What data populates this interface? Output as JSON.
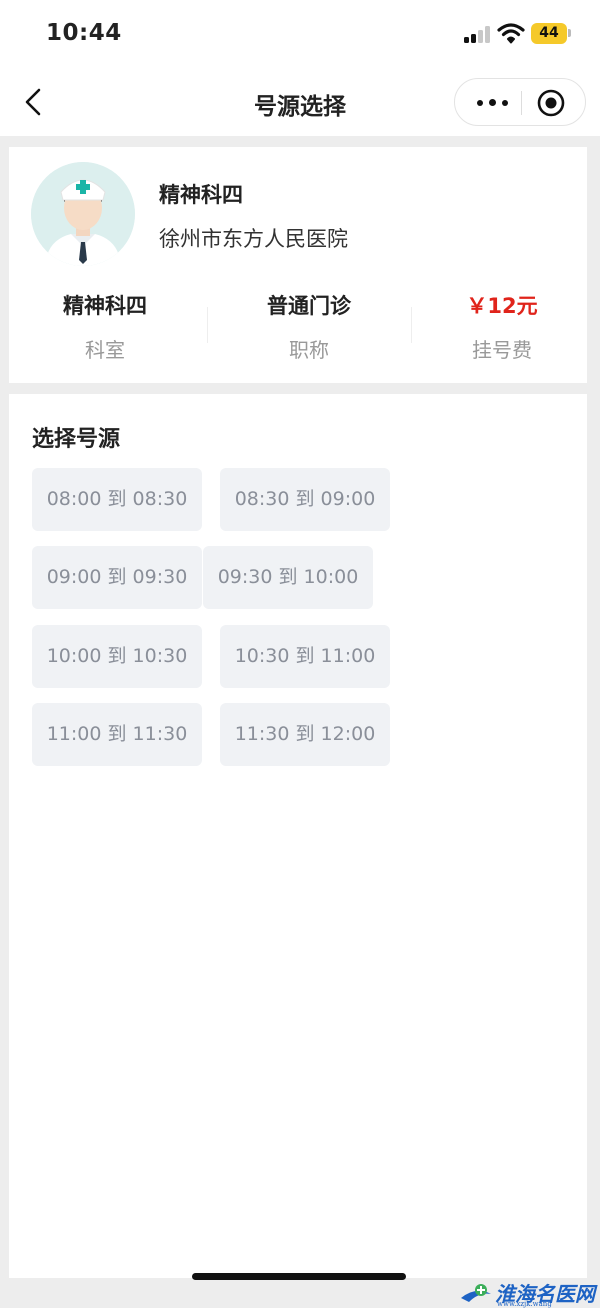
{
  "status_bar": {
    "time": "10:44",
    "battery": "44"
  },
  "nav": {
    "title": "号源选择",
    "icons": [
      "back-icon",
      "more-icon",
      "close-icon"
    ]
  },
  "doctor": {
    "name": "精神科四",
    "hospital": "徐州市东方人民医院",
    "info": [
      {
        "value": "精神科四",
        "label": "科室"
      },
      {
        "value": "普通门诊",
        "label": "职称"
      },
      {
        "value": "￥12元",
        "label": "挂号费"
      }
    ]
  },
  "slots": {
    "title": "选择号源",
    "items": [
      "08:00 到 08:30",
      "08:30 到 09:00",
      "09:00 到 09:30",
      "09:30 到 10:00",
      "10:00 到 10:30",
      "10:30 到 11:00",
      "11:00 到 11:30",
      "11:30 到 12:00"
    ]
  },
  "watermark": {
    "text": "淮海名医网",
    "url": "www.xzjk.wang"
  },
  "colors": {
    "fee": "#e0241b",
    "slot_bg": "#f0f2f5",
    "slot_text": "#8a8f99",
    "page_bg": "#ededed",
    "battery": "#f5c92a"
  }
}
